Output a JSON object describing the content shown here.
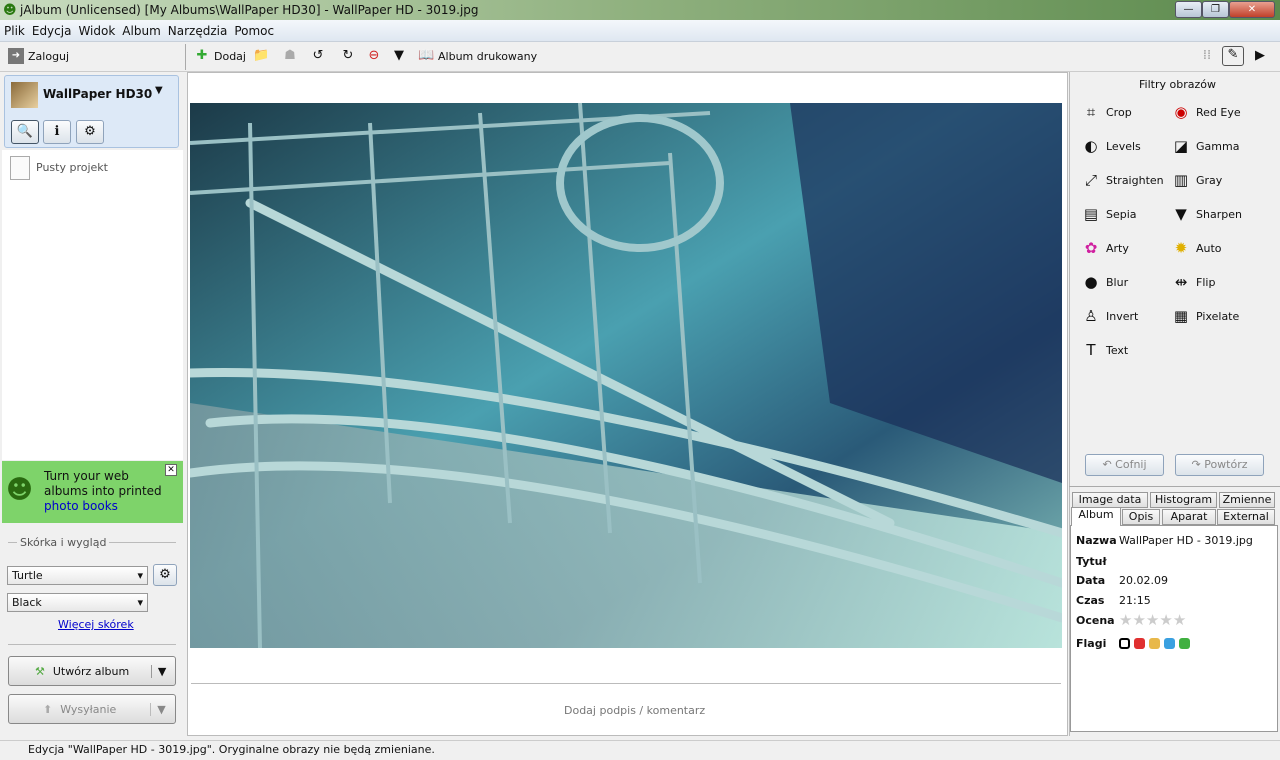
{
  "window": {
    "title": "jAlbum (Unlicensed) [My Albums\\WallPaper HD30] - WallPaper HD - 3019.jpg",
    "min": "—",
    "max": "❐",
    "close": "✕"
  },
  "menu": [
    "Plik",
    "Edycja",
    "Widok",
    "Album",
    "Narzędzia",
    "Pomoc"
  ],
  "toolbar": {
    "login": "Zaloguj",
    "add": "Dodaj",
    "printed_album": "Album drukowany"
  },
  "project": {
    "name": "WallPaper HD30",
    "empty": "Pusty projekt"
  },
  "promo": {
    "text": "Turn your web albums into printed",
    "link": "photo books"
  },
  "skin": {
    "section": "Skórka i wygląd",
    "skin": "Turtle",
    "style": "Black",
    "more": "Więcej skórek"
  },
  "buttons": {
    "make": "Utwórz album",
    "upload": "Wysyłanie"
  },
  "caption_placeholder": "Dodaj podpis / komentarz",
  "filters": {
    "title": "Filtry obrazów",
    "items": [
      {
        "label": "Crop",
        "icon": "⌗"
      },
      {
        "label": "Red Eye",
        "icon": "◉"
      },
      {
        "label": "Levels",
        "icon": "◐"
      },
      {
        "label": "Gamma",
        "icon": "◪"
      },
      {
        "label": "Straighten",
        "icon": "⤢"
      },
      {
        "label": "Gray",
        "icon": "▥"
      },
      {
        "label": "Sepia",
        "icon": "▤"
      },
      {
        "label": "Sharpen",
        "icon": "▼"
      },
      {
        "label": "Arty",
        "icon": "✿"
      },
      {
        "label": "Auto",
        "icon": "✹"
      },
      {
        "label": "Blur",
        "icon": "●"
      },
      {
        "label": "Flip",
        "icon": "⇹"
      },
      {
        "label": "Invert",
        "icon": "♙"
      },
      {
        "label": "Pixelate",
        "icon": "▦"
      },
      {
        "label": "Text",
        "icon": "T"
      }
    ],
    "undo": "Cofnij",
    "redo": "Powtórz"
  },
  "tabs": {
    "row1": [
      "Image data",
      "Histogram",
      "Zmienne"
    ],
    "row2": [
      "Album",
      "Opis",
      "Aparat",
      "External"
    ]
  },
  "props": {
    "name_l": "Nazwa",
    "name": "WallPaper HD - 3019.jpg",
    "title_l": "Tytuł",
    "title": "",
    "date_l": "Data",
    "date": "20.02.09",
    "time_l": "Czas",
    "time": "21:15",
    "rating_l": "Ocena",
    "rating": 0,
    "flags_l": "Flagi",
    "flag_colors": [
      "#ffffff",
      "#e03030",
      "#e8b84a",
      "#3aa0e0",
      "#40b040"
    ]
  },
  "status": "Edycja \"WallPaper HD - 3019.jpg\". Oryginalne obrazy nie będą zmieniane."
}
